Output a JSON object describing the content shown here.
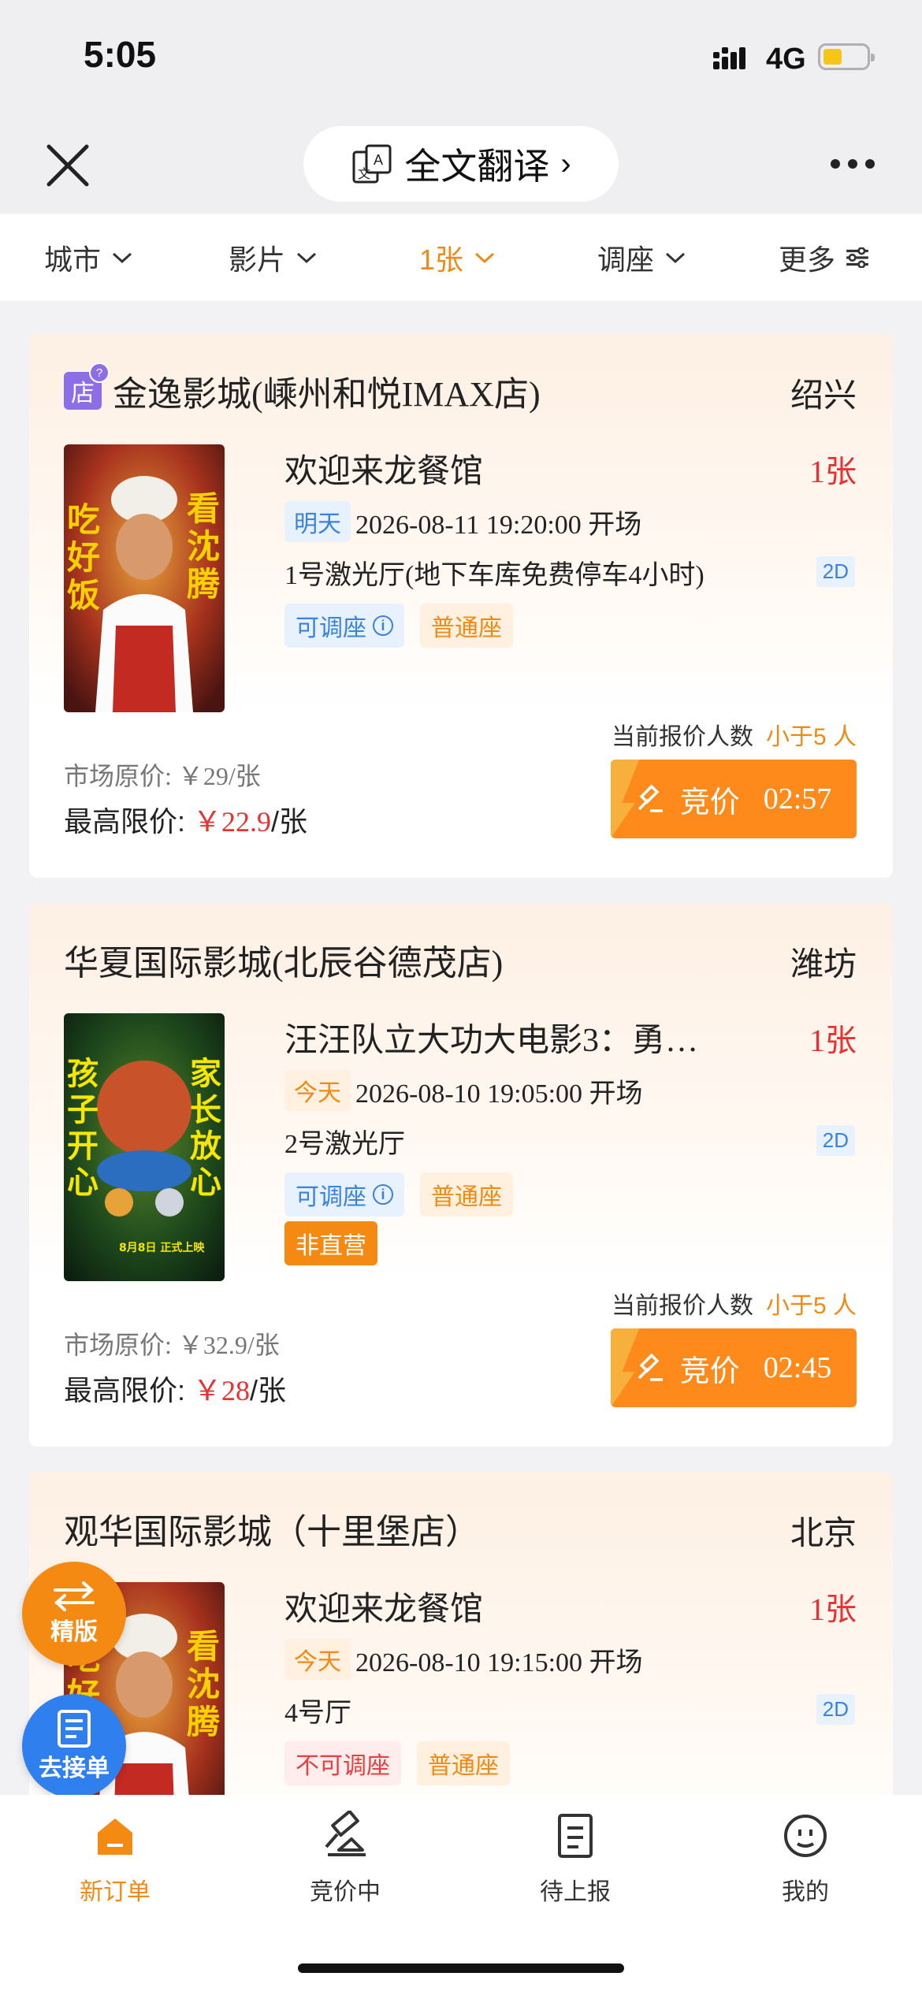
{
  "status": {
    "time": "5:05",
    "network": "4G",
    "battery_level": 0.45
  },
  "nav": {
    "translate_label": "全文翻译"
  },
  "filters": [
    {
      "label": "城市",
      "active": false
    },
    {
      "label": "影片",
      "active": false
    },
    {
      "label": "1张",
      "active": true
    },
    {
      "label": "调座",
      "active": false
    },
    {
      "label": "更多",
      "active": false
    }
  ],
  "orders": [
    {
      "store_badge": "店",
      "cinema": "金逸影城(嵊州和悦IMAX店)",
      "city": "绍兴",
      "movie": "欢迎来龙餐馆",
      "tickets": "1张",
      "day": "明天",
      "showtime": "2026-08-11 19:20:00 开场",
      "hall": "1号激光厅(地下车库免费停车4小时)",
      "dimension": "2D",
      "adjust": "可调座",
      "seat": "普通座",
      "bidders_label": "当前报价人数",
      "bidders_value": "小于5 人",
      "market_price": "市场原价: ￥29/张",
      "limit_label": "最高限价:",
      "limit_price": "￥22.9",
      "limit_unit": "/张",
      "bid_label": "竞价",
      "countdown": "02:57",
      "poster_left": "吃好饭",
      "poster_right": "看沈腾"
    },
    {
      "cinema": "华夏国际影城(北辰谷德茂店)",
      "city": "潍坊",
      "movie": "汪汪队立大功大电影3：勇…",
      "tickets": "1张",
      "day": "今天",
      "showtime": "2026-08-10 19:05:00 开场",
      "hall": "2号激光厅",
      "dimension": "2D",
      "adjust": "可调座",
      "seat": "普通座",
      "extra_tag": "非直营",
      "bidders_label": "当前报价人数",
      "bidders_value": "小于5 人",
      "market_price": "市场原价: ￥32.9/张",
      "limit_label": "最高限价:",
      "limit_price": "￥28",
      "limit_unit": "/张",
      "bid_label": "竞价",
      "countdown": "02:45",
      "poster_left": "孩子开心",
      "poster_right": "家长放心",
      "poster_date": "8月8日 正式上映"
    },
    {
      "cinema": "观华国际影城（十里堡店）",
      "city": "北京",
      "movie": "欢迎来龙餐馆",
      "tickets": "1张",
      "day": "今天",
      "showtime": "2026-08-10 19:15:00 开场",
      "hall": "4号厅",
      "dimension": "2D",
      "adjust": "不可调座",
      "seat": "普通座",
      "poster_left": "吃好饭",
      "poster_right": "看沈腾"
    }
  ],
  "floating": {
    "premium": "精版",
    "take_order": "去接单"
  },
  "tabs": [
    {
      "label": "新订单",
      "icon": "home-icon",
      "active": true
    },
    {
      "label": "竞价中",
      "icon": "gavel-icon",
      "active": false
    },
    {
      "label": "待上报",
      "icon": "report-icon",
      "active": false
    },
    {
      "label": "我的",
      "icon": "profile-icon",
      "active": false
    }
  ],
  "colors": {
    "accent": "#f08a14",
    "price_red": "#e63232",
    "blue": "#3a82e0",
    "purple": "#8e6ee6"
  }
}
